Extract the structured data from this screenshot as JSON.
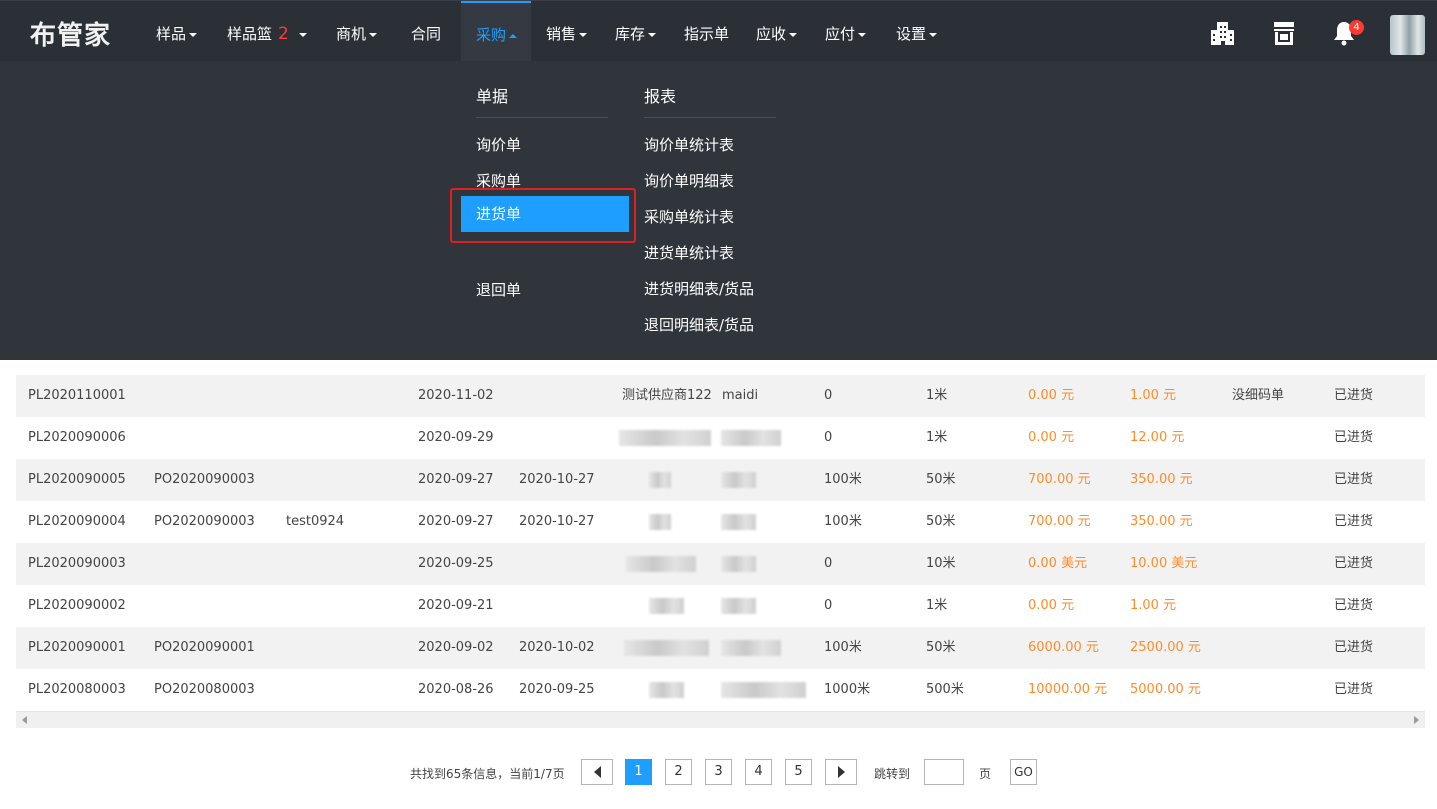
{
  "app": {
    "logo": "布管家"
  },
  "nav": [
    {
      "label": "样品",
      "caret": true
    },
    {
      "label": "样品篮",
      "badge": "2",
      "caret": true
    },
    {
      "label": "商机",
      "caret": true
    },
    {
      "label": "合同",
      "caret": false
    },
    {
      "label": "采购",
      "caret": true,
      "active": true
    },
    {
      "label": "销售",
      "caret": true
    },
    {
      "label": "库存",
      "caret": true
    },
    {
      "label": "指示单",
      "caret": false
    },
    {
      "label": "应收",
      "caret": true
    },
    {
      "label": "应付",
      "caret": true
    },
    {
      "label": "设置",
      "caret": true
    }
  ],
  "header_icons": {
    "company": "building-icon",
    "store": "store-icon",
    "notifications": "bell-icon",
    "bell_count": "4"
  },
  "dropdown": {
    "col1_title": "单据",
    "col1_items": [
      "询价单",
      "采购单",
      "进货单",
      "退回单"
    ],
    "selected": "进货单",
    "col2_title": "报表",
    "col2_items": [
      "询价单统计表",
      "询价单明细表",
      "采购单统计表",
      "进货单统计表",
      "进货明细表/货品",
      "退回明细表/货品"
    ]
  },
  "table": {
    "rows": [
      {
        "no": "PL2020110001",
        "po": "",
        "ref": "",
        "date": "2020-11-02",
        "due": "",
        "supplier": "测试供应商122",
        "handler": "maidi",
        "qty1": "0",
        "qty2": "1米",
        "amt1": "0.00 元",
        "amt2": "1.00 元",
        "note": "没细码单",
        "status": "已进货"
      },
      {
        "no": "PL2020090006",
        "po": "",
        "ref": "",
        "date": "2020-09-29",
        "due": "",
        "supplier": "",
        "handler": "",
        "qty1": "0",
        "qty2": "1米",
        "amt1": "0.00 元",
        "amt2": "12.00 元",
        "note": "",
        "status": "已进货"
      },
      {
        "no": "PL2020090005",
        "po": "PO2020090003",
        "ref": "",
        "date": "2020-09-27",
        "due": "2020-10-27",
        "supplier": "",
        "handler": "",
        "qty1": "100米",
        "qty2": "50米",
        "amt1": "700.00 元",
        "amt2": "350.00 元",
        "note": "",
        "status": "已进货"
      },
      {
        "no": "PL2020090004",
        "po": "PO2020090003",
        "ref": "test0924",
        "date": "2020-09-27",
        "due": "2020-10-27",
        "supplier": "",
        "handler": "",
        "qty1": "100米",
        "qty2": "50米",
        "amt1": "700.00 元",
        "amt2": "350.00 元",
        "note": "",
        "status": "已进货"
      },
      {
        "no": "PL2020090003",
        "po": "",
        "ref": "",
        "date": "2020-09-25",
        "due": "",
        "supplier": "",
        "handler": "",
        "qty1": "0",
        "qty2": "10米",
        "amt1": "0.00 美元",
        "amt2": "10.00 美元",
        "note": "",
        "status": "已进货"
      },
      {
        "no": "PL2020090002",
        "po": "",
        "ref": "",
        "date": "2020-09-21",
        "due": "",
        "supplier": "",
        "handler": "",
        "qty1": "0",
        "qty2": "1米",
        "amt1": "0.00 元",
        "amt2": "1.00 元",
        "note": "",
        "status": "已进货"
      },
      {
        "no": "PL2020090001",
        "po": "PO2020090001",
        "ref": "",
        "date": "2020-09-02",
        "due": "2020-10-02",
        "supplier": "",
        "handler": "",
        "qty1": "100米",
        "qty2": "50米",
        "amt1": "6000.00 元",
        "amt2": "2500.00 元",
        "note": "",
        "status": "已进货"
      },
      {
        "no": "PL2020080003",
        "po": "PO2020080003",
        "ref": "",
        "date": "2020-08-26",
        "due": "2020-09-25",
        "supplier": "",
        "handler": "",
        "qty1": "1000米",
        "qty2": "500米",
        "amt1": "10000.00 元",
        "amt2": "5000.00 元",
        "note": "",
        "status": "已进货"
      }
    ]
  },
  "pagination": {
    "summary": "共找到65条信息，当前1/7页",
    "pages": [
      "1",
      "2",
      "3",
      "4",
      "5"
    ],
    "current": "1",
    "jump_label": "跳转到",
    "page_unit": "页",
    "go_label": "GO"
  },
  "colors": {
    "accent": "#1e9fff",
    "nav_bg": "#2b2f36",
    "amount": "#ff8c2a",
    "highlight_box": "#e02020"
  }
}
